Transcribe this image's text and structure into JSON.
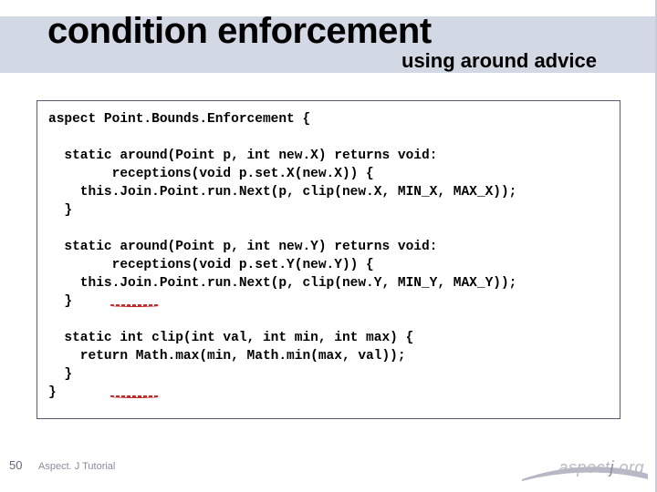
{
  "slide": {
    "title": "condition enforcement",
    "subtitle": "using around advice",
    "page_number": "50",
    "footer": "Aspect. J Tutorial"
  },
  "code": {
    "line01": "aspect Point.Bounds.Enforcement {",
    "line02": "",
    "line03": "  static around(Point p, int new.X) returns void:",
    "line04": "        receptions(void p.set.X(new.X)) {",
    "line05": "    this.Join.Point.run.Next(p, clip(new.X, MIN_X, MAX_X));",
    "line06": "  }",
    "line07": "",
    "line08": "  static around(Point p, int new.Y) returns void:",
    "line09": "        receptions(void p.set.Y(new.Y)) {",
    "line10": "    this.Join.Point.run.Next(p, clip(new.Y, MIN_Y, MAX_Y));",
    "line11": "  }",
    "line12": "",
    "line13": "  static int clip(int val, int min, int max) {",
    "line14": "    return Math.max(min, Math.min(max, val));",
    "line15": "  }",
    "line16": "}"
  },
  "logo": {
    "text_a": "aspect",
    "text_j": "j",
    "text_org": ".org"
  }
}
